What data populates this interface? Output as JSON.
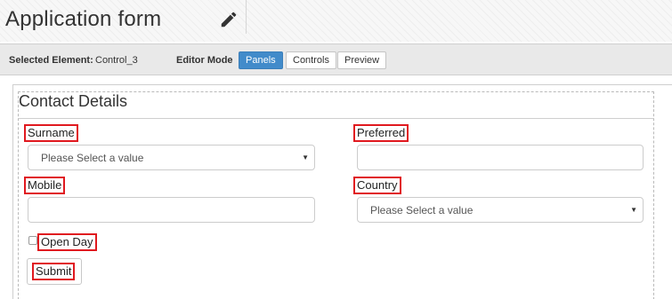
{
  "header": {
    "title": "Application form",
    "edit_icon": "pencil-icon"
  },
  "toolbar": {
    "selected_element_label": "Selected Element:",
    "selected_element_value": "Control_3",
    "editor_mode_label": "Editor Mode",
    "modes": [
      "Panels",
      "Controls",
      "Preview"
    ],
    "active_mode": "Panels"
  },
  "panel": {
    "title": "Contact Details",
    "fields": {
      "surname": {
        "label": "Surname",
        "placeholder": "Please Select a value"
      },
      "preferred": {
        "label": "Preferred",
        "value": ""
      },
      "mobile": {
        "label": "Mobile",
        "value": ""
      },
      "country": {
        "label": "Country",
        "placeholder": "Please Select a value"
      },
      "open_day": {
        "label": "Open Day",
        "checked": false
      }
    },
    "submit_label": "Submit"
  },
  "colors": {
    "accent": "#428bca",
    "highlight_border": "#e0191f"
  }
}
